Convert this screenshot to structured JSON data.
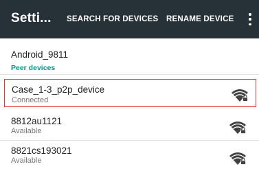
{
  "appbar": {
    "title": "Setti...",
    "actions": {
      "search": "SEARCH FOR DEVICES",
      "rename": "RENAME DEVICE"
    }
  },
  "this_device": {
    "name": "Android_9811"
  },
  "peer_section": {
    "header": "Peer devices"
  },
  "peers": [
    {
      "name": "Case_1-3_p2p_device",
      "status": "Connected",
      "icon": "wifi-lock-icon"
    },
    {
      "name": "8812au1121",
      "status": "Available",
      "icon": "wifi-lock-icon"
    },
    {
      "name": "8821cs193021",
      "status": "Available",
      "icon": "wifi-lock-icon"
    }
  ],
  "colors": {
    "appbar": "#263238",
    "accent": "#009688",
    "highlight_border": "#e53935"
  }
}
